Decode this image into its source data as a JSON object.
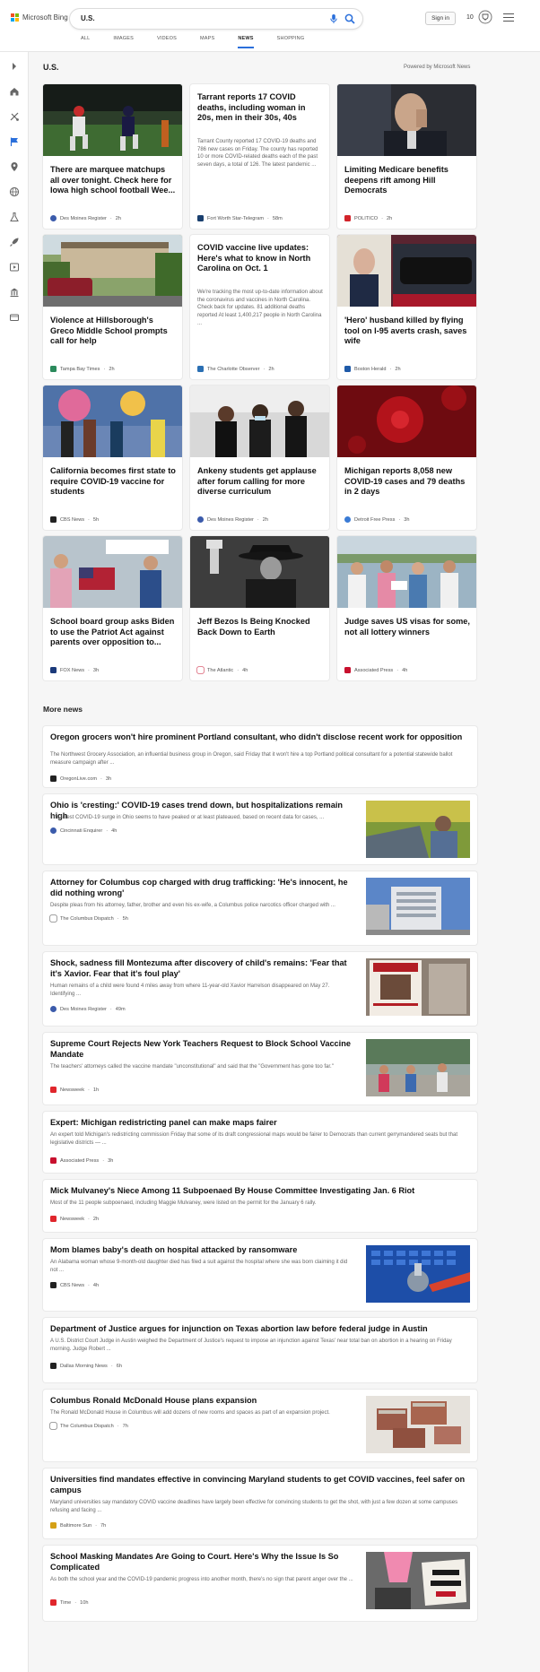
{
  "header": {
    "logo_text": "Microsoft Bing",
    "search_value": "U.S.",
    "signin_label": "Sign in",
    "points": "10",
    "tabs": [
      {
        "label": "ALL"
      },
      {
        "label": "IMAGES"
      },
      {
        "label": "VIDEOS"
      },
      {
        "label": "MAPS"
      },
      {
        "label": "NEWS"
      },
      {
        "label": "SHOPPING"
      }
    ],
    "active_tab": "NEWS"
  },
  "rail": {
    "icons": [
      "expand-icon",
      "home-icon",
      "sports-icon",
      "flag-icon",
      "location-icon",
      "globe-icon",
      "science-icon",
      "rocket-icon",
      "entertainment-icon",
      "money-icon",
      "video-icon"
    ]
  },
  "section": {
    "title": "U.S.",
    "powered_by": "Powered by Microsoft News"
  },
  "cards": [
    {
      "title": "There are marquee matchups all over tonight. Check here for Iowa high school football Wee...",
      "source": "Des Moines Register",
      "time": "2h",
      "source_color": "#3b5bab"
    },
    {
      "title": "Tarrant reports 17 COVID deaths, including woman in 20s, men in their 30s, 40s",
      "snippet": "Tarrant County reported 17 COVID-19 deaths and 786 new cases on Friday. The county has reported 10 or more COVID-related deaths each of the past seven days, a total of 126. The latest pandemic ...",
      "source": "Fort Worth Star-Telegram",
      "time": "58m",
      "source_color": "#1a3f6e"
    },
    {
      "title": "Limiting Medicare benefits deepens rift among Hill Democrats",
      "source": "POLITICO",
      "time": "2h",
      "source_color": "#d2232a"
    },
    {
      "title": "Violence at Hillsborough's Greco Middle School prompts call for help",
      "source": "Tampa Bay Times",
      "time": "2h",
      "source_color": "#2b8a5c"
    },
    {
      "title": "COVID vaccine live updates: Here's what to know in North Carolina on Oct. 1",
      "snippet": "We're tracking the most up-to-date information about the coronavirus and vaccines in North Carolina. Check back for updates. 81 additional deaths reported At least 1,400,217 people in North Carolina ...",
      "source": "The Charlotte Observer",
      "time": "2h",
      "source_color": "#2a6fb3"
    },
    {
      "title": "'Hero' husband killed by flying tool on I-95 averts crash, saves wife",
      "source": "Boston Herald",
      "time": "2h",
      "source_color": "#1f5aa8"
    },
    {
      "title": "California becomes first state to require COVID-19 vaccine for students",
      "source": "CBS News",
      "time": "5h",
      "source_color": "#222222"
    },
    {
      "title": "Ankeny students get applause after forum calling for more diverse curriculum",
      "source": "Des Moines Register",
      "time": "2h",
      "source_color": "#3b5bab"
    },
    {
      "title": "Michigan reports 8,058 new COVID-19 cases and 79 deaths in 2 days",
      "source": "Detroit Free Press",
      "time": "3h",
      "source_color": "#3a7bd5"
    },
    {
      "title": "School board group asks Biden to use the Patriot Act against parents over opposition to...",
      "source": "FOX News",
      "time": "3h",
      "source_color": "#1b3a7a"
    },
    {
      "title": "Jeff Bezos Is Being Knocked Back Down to Earth",
      "source": "The Atlantic",
      "time": "4h",
      "source_color": "#c8102e"
    },
    {
      "title": "Judge saves US visas for some, not all lottery winners",
      "source": "Associated Press",
      "time": "4h",
      "source_color": "#c8102e"
    }
  ],
  "more": {
    "title": "More news",
    "items": [
      {
        "title": "Oregon grocers won't hire prominent Portland consultant, who didn't disclose recent work for opposition",
        "snippet": "The Northwest Grocery Association, an influential business group in Oregon, said Friday that it won't hire a top Portland political consultant for a potential statewide ballot measure campaign after ...",
        "source": "OregonLive.com",
        "time": "3h",
        "source_color": "#222222"
      },
      {
        "title": "Ohio is 'cresting:' COVID-19 cases trend down, but hospitalizations remain high",
        "snippet": "The latest COVID-19 surge in Ohio seems to have peaked or at least plateaued, based on recent data for cases, ...",
        "source": "Cincinnati Enquirer",
        "time": "4h",
        "source_color": "#3b5bab"
      },
      {
        "title": "Attorney for Columbus cop charged with drug trafficking: 'He's innocent, he did nothing wrong'",
        "snippet": "Despite pleas from his attorney, father, brother and even his ex-wife, a Columbus police narcotics officer charged with ...",
        "source": "The Columbus Dispatch",
        "time": "5h",
        "source_color": "#444444"
      },
      {
        "title": "Shock, sadness fill Montezuma after discovery of child's remains: 'Fear that it's Xavior. Fear that it's foul play'",
        "snippet": "Human remains of a child were found 4 miles away from where 11-year-old Xavior Harrelson disappeared on May 27. Identifying ...",
        "source": "Des Moines Register",
        "time": "49m",
        "source_color": "#3b5bab"
      },
      {
        "title": "Supreme Court Rejects New York Teachers Request to Block School Vaccine Mandate",
        "snippet": "The teachers' attorneys called the vaccine mandate \"unconstitutional\" and said that the \"Government has gone too far.\"",
        "source": "Newsweek",
        "time": "1h",
        "source_color": "#e0262c"
      },
      {
        "title": "Expert: Michigan redistricting panel can make maps fairer",
        "snippet": "An expert told Michigan's redistricting commission Friday that some of its draft congressional maps would be fairer to Democrats than current gerrymandered seats but that legislative districts — ...",
        "source": "Associated Press",
        "time": "3h",
        "source_color": "#c8102e"
      },
      {
        "title": "Mick Mulvaney's Niece Among 11 Subpoenaed By House Committee Investigating Jan. 6 Riot",
        "snippet": "Most of the 11 people subpoenaed, including Maggie Mulvaney, were listed on the permit for the January 6 rally.",
        "source": "Newsweek",
        "time": "2h",
        "source_color": "#e0262c"
      },
      {
        "title": "Mom blames baby's death on hospital attacked by ransomware",
        "snippet": "An Alabama woman whose 9-month-old daughter died has filed a suit against the hospital where she was born claiming it did not ...",
        "source": "CBS News",
        "time": "4h",
        "source_color": "#222222"
      },
      {
        "title": "Department of Justice argues for injunction on Texas abortion law before federal judge in Austin",
        "snippet": "A U.S. District Court Judge in Austin weighed the Department of Justice's request to impose an injunction against Texas' near total ban on abortion in a hearing on Friday morning. Judge Robert ...",
        "source": "Dallas Morning News",
        "time": "6h",
        "source_color": "#222222"
      },
      {
        "title": "Columbus Ronald McDonald House plans expansion",
        "snippet": "The Ronald McDonald House in Columbus will add dozens of new rooms and spaces as part of an expansion project.",
        "source": "The Columbus Dispatch",
        "time": "7h",
        "source_color": "#444444"
      },
      {
        "title": "Universities find mandates effective in convincing Maryland students to get COVID vaccines, feel safer on campus",
        "snippet": "Maryland universities say mandatory COVID vaccine deadlines have largely been effective for convincing students to get the shot, with just a few dozen at some campuses refusing and facing ...",
        "source": "Baltimore Sun",
        "time": "7h",
        "source_color": "#d4a017"
      },
      {
        "title": "School Masking Mandates Are Going to Court. Here's Why the Issue Is So Complicated",
        "snippet": "As both the school year and the COVID-19 pandemic progress into another month, there's no sign that parent anger over the ...",
        "source": "Time",
        "time": "10h",
        "source_color": "#e0262c"
      }
    ]
  }
}
